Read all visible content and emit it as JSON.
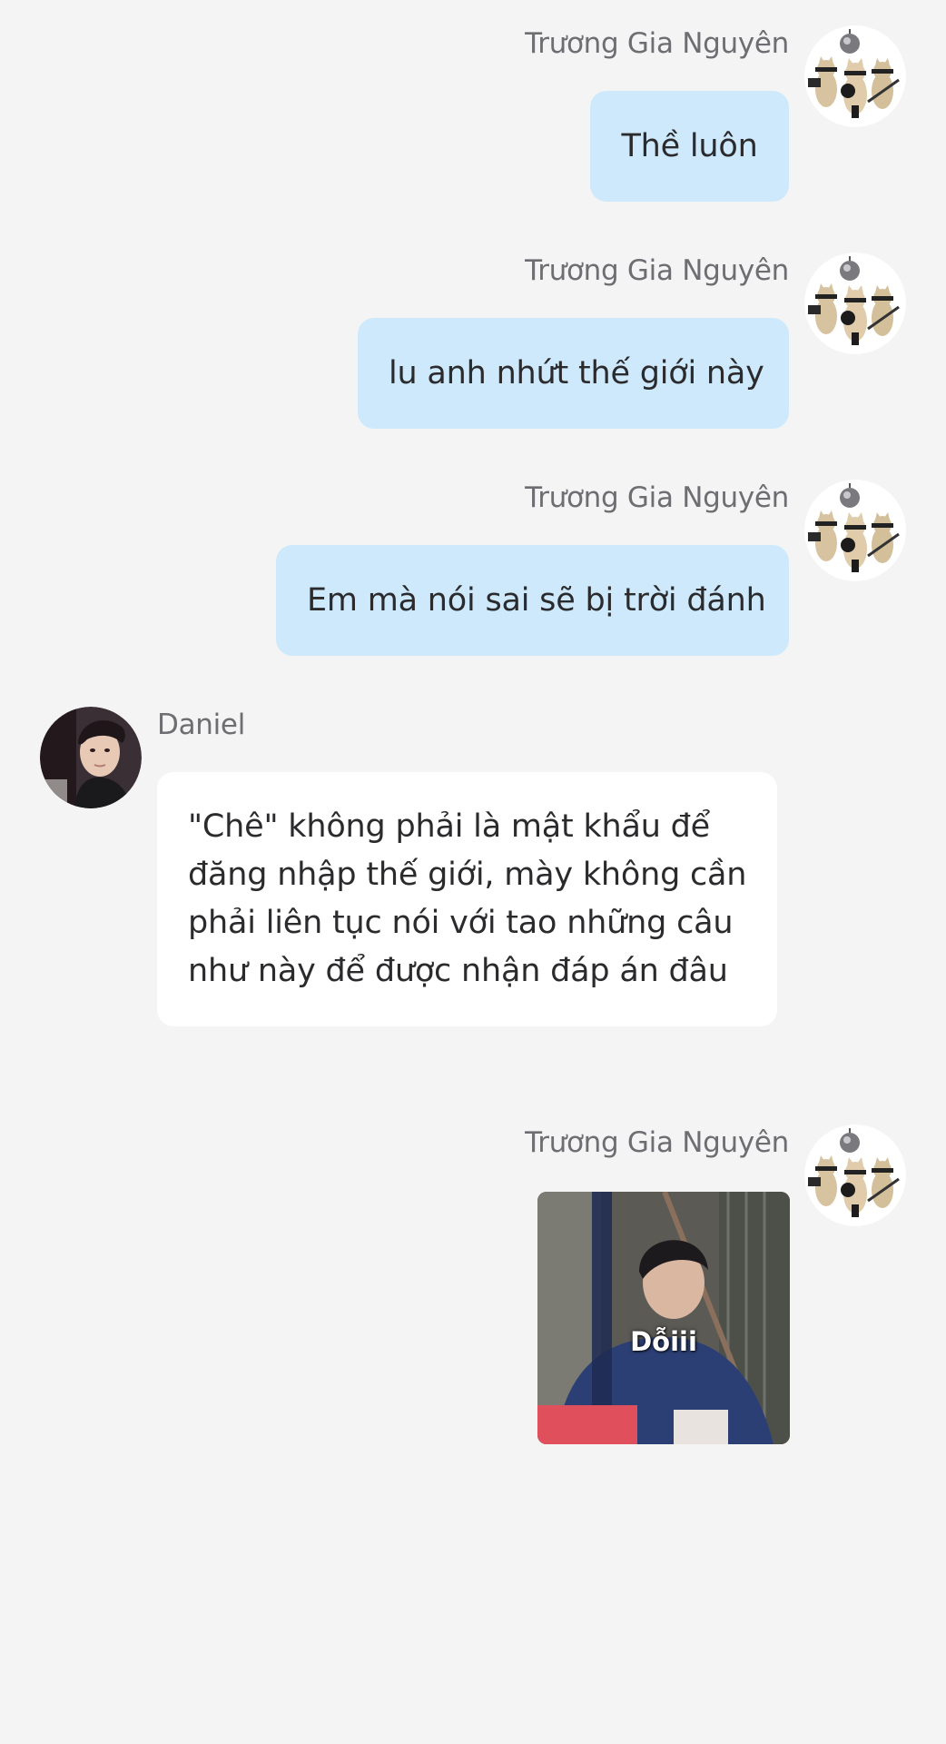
{
  "colors": {
    "background": "#f4f4f5",
    "outgoing_bubble": "#cde9fb",
    "incoming_bubble": "#ffffff",
    "name_text": "#6e6e72",
    "message_text": "#2b2b2e"
  },
  "messages": [
    {
      "direction": "outgoing",
      "sender": "Trương Gia Nguyên",
      "avatar_icon": "cats-band-avatar",
      "text": "Thề luôn"
    },
    {
      "direction": "outgoing",
      "sender": "Trương Gia Nguyên",
      "avatar_icon": "cats-band-avatar",
      "text": "lu anh nhứt thế giới này"
    },
    {
      "direction": "outgoing",
      "sender": "Trương Gia Nguyên",
      "avatar_icon": "cats-band-avatar",
      "text": "Em mà nói sai sẽ bị trời đánh"
    },
    {
      "direction": "incoming",
      "sender": "Daniel",
      "avatar_icon": "person-portrait-avatar",
      "text": "\"Chê\" không phải là mật khẩu để đăng nhập thế giới, mày không cần phải liên tục nói với tao những câu như này để được nhận đáp án đâu"
    },
    {
      "direction": "outgoing",
      "sender": "Trương Gia Nguyên",
      "avatar_icon": "cats-band-avatar",
      "sticker_caption": "Dỗiii"
    }
  ]
}
